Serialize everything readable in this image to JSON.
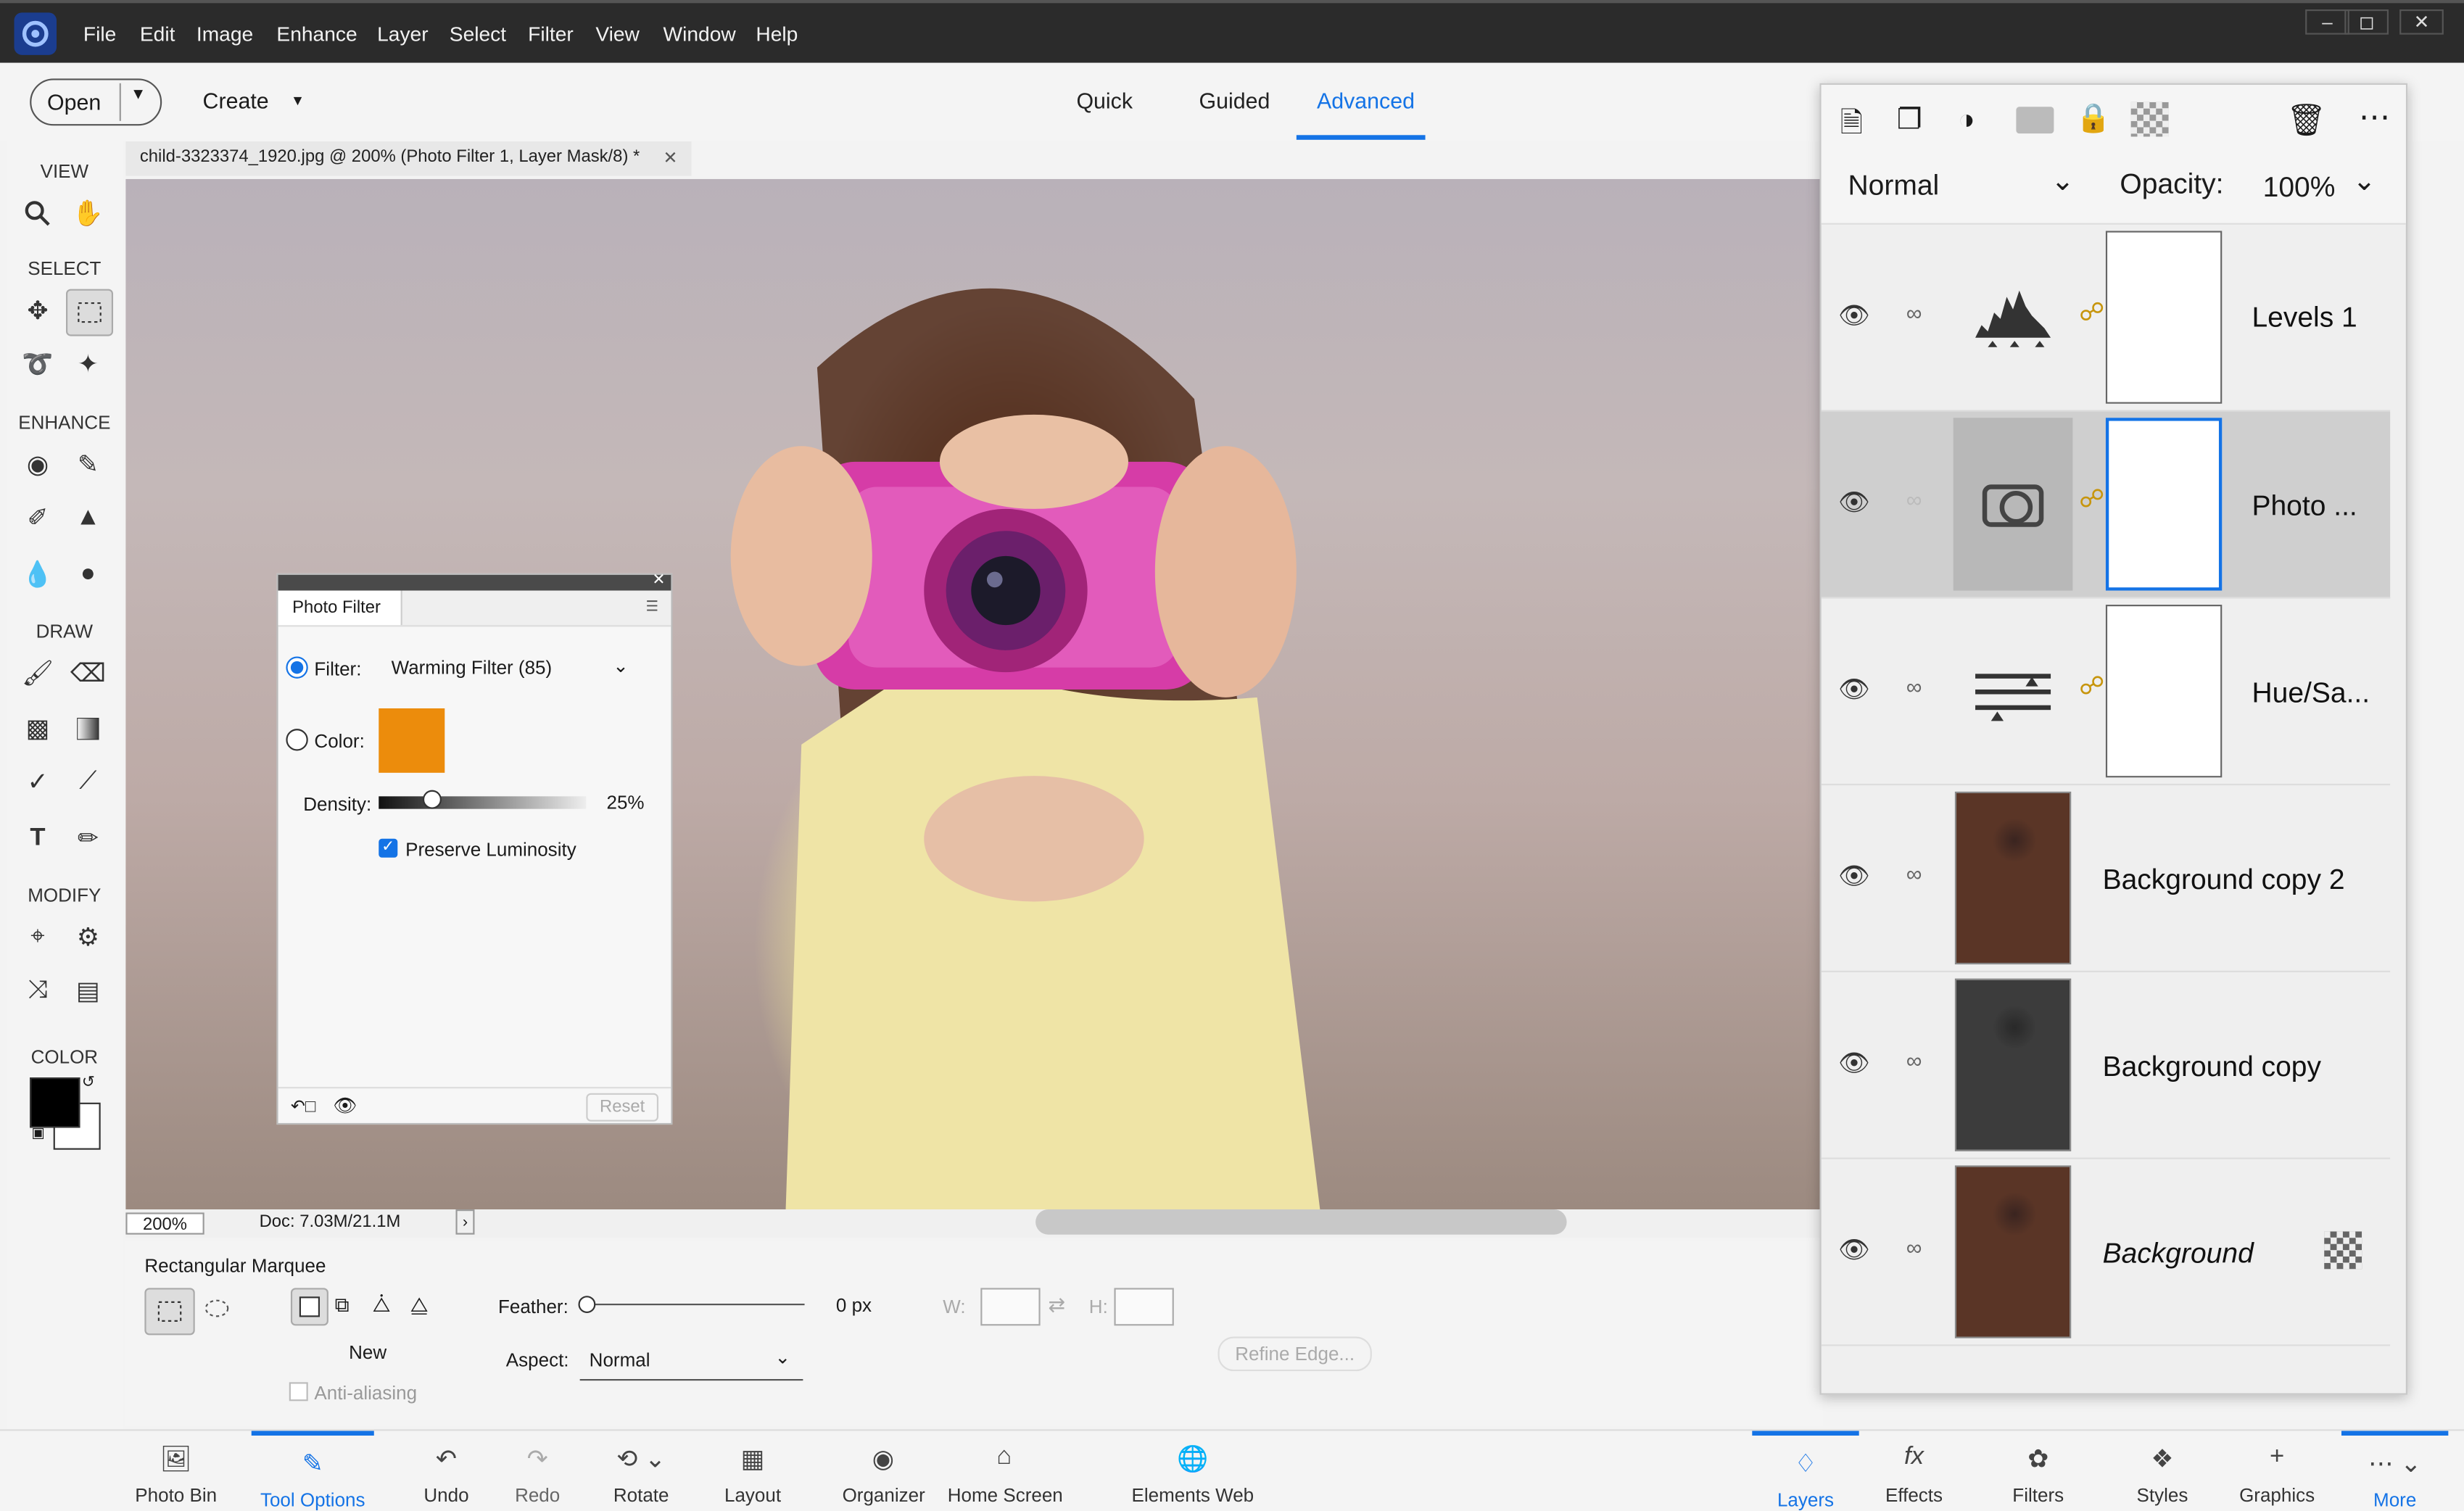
{
  "menubar": {
    "items": [
      "File",
      "Edit",
      "Image",
      "Enhance",
      "Layer",
      "Select",
      "Filter",
      "View",
      "Window",
      "Help"
    ]
  },
  "topbar": {
    "open_label": "Open",
    "create_label": "Create",
    "modes": [
      "Quick",
      "Guided",
      "Advanced"
    ],
    "active_mode": "Advanced"
  },
  "toolbox": {
    "sections": [
      "VIEW",
      "SELECT",
      "ENHANCE",
      "DRAW",
      "MODIFY",
      "COLOR"
    ]
  },
  "document": {
    "tab_title": "child-3323374_1920.jpg @ 200% (Photo Filter 1, Layer Mask/8) *",
    "zoom": "200%",
    "doc_size": "Doc: 7.03M/21.1M"
  },
  "photo_filter": {
    "title": "Photo Filter",
    "filter_label": "Filter:",
    "filter_value": "Warming Filter (85)",
    "color_label": "Color:",
    "color_swatch": "#ec8c0c",
    "density_label": "Density:",
    "density_value": "25%",
    "density_fraction": 0.25,
    "preserve_label": "Preserve Luminosity",
    "preserve_checked": true,
    "reset_label": "Reset"
  },
  "tool_options": {
    "tool_name": "Rectangular Marquee",
    "new_label": "New",
    "antialias_label": "Anti-aliasing",
    "feather_label": "Feather:",
    "feather_value": "0 px",
    "w_label": "W:",
    "h_label": "H:",
    "aspect_label": "Aspect:",
    "aspect_value": "Normal",
    "refine_label": "Refine Edge..."
  },
  "layers_panel": {
    "blend_mode": "Normal",
    "opacity_label": "Opacity:",
    "opacity_value": "100%",
    "layers": [
      {
        "name": "Levels 1",
        "kind": "adjustment",
        "selected": false
      },
      {
        "name": "Photo ...",
        "kind": "adjustment",
        "selected": true
      },
      {
        "name": "Hue/Sa...",
        "kind": "adjustment",
        "selected": false
      },
      {
        "name": "Background copy 2",
        "kind": "image",
        "selected": false
      },
      {
        "name": "Background copy",
        "kind": "image",
        "selected": false
      },
      {
        "name": "Background",
        "kind": "image",
        "selected": false
      }
    ]
  },
  "bottombar": {
    "items": [
      "Photo Bin",
      "Tool Options",
      "Undo",
      "Redo",
      "Rotate",
      "Layout",
      "Organizer",
      "Home Screen",
      "Elements Web",
      "Layers",
      "Effects",
      "Filters",
      "Styles",
      "Graphics",
      "More"
    ]
  },
  "colors": {
    "accent": "#1473e6",
    "menubar": "#2b2b2b",
    "foreground_color": "#000000",
    "background_color": "#ffffff"
  }
}
